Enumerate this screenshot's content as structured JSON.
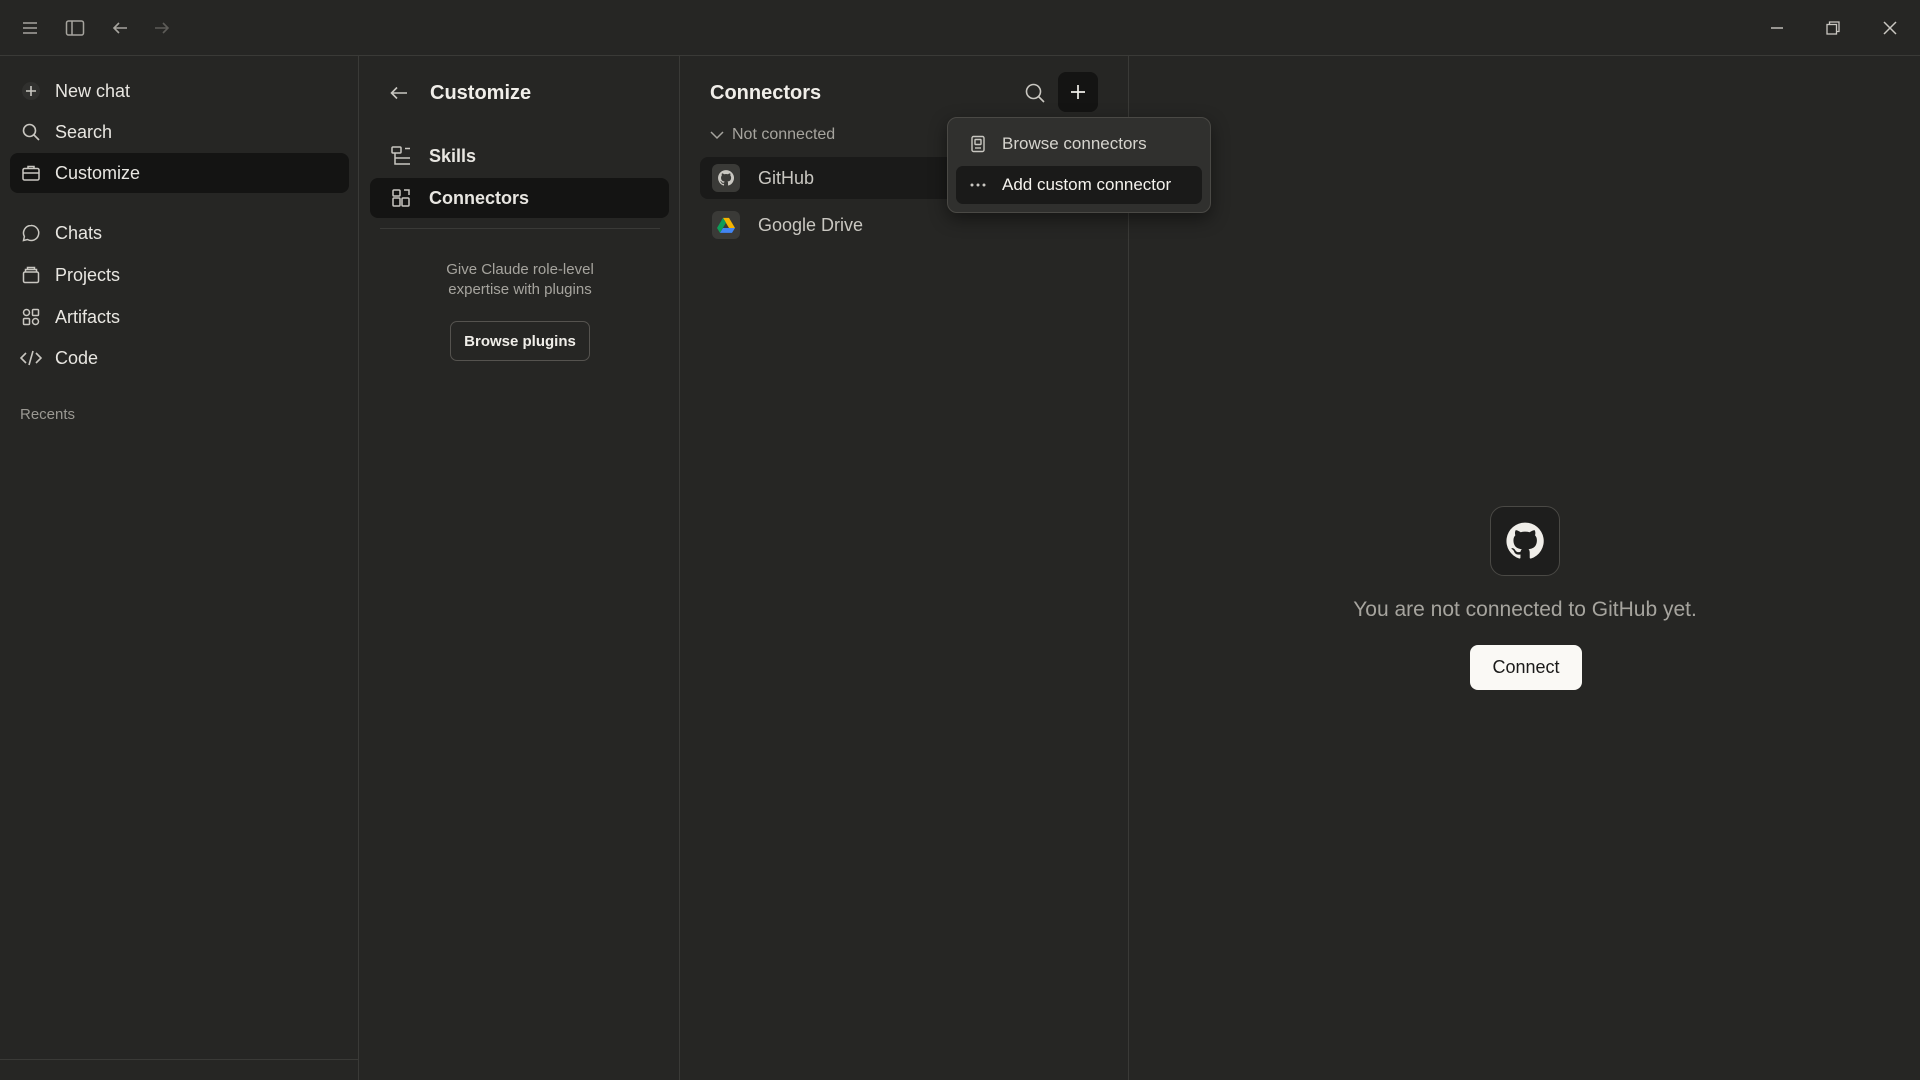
{
  "sidebar": {
    "items": [
      {
        "label": "New chat",
        "icon": "plus-icon"
      },
      {
        "label": "Search",
        "icon": "search-icon"
      },
      {
        "label": "Customize",
        "icon": "briefcase-icon"
      },
      {
        "label": "Chats",
        "icon": "chat-bubble-icon"
      },
      {
        "label": "Projects",
        "icon": "folder-stack-icon"
      },
      {
        "label": "Artifacts",
        "icon": "artifacts-grid-icon"
      },
      {
        "label": "Code",
        "icon": "code-icon"
      }
    ],
    "recents_label": "Recents"
  },
  "customize": {
    "title": "Customize",
    "items": [
      {
        "label": "Skills",
        "icon": "skills-icon"
      },
      {
        "label": "Connectors",
        "icon": "connectors-icon"
      }
    ],
    "description_line1": "Give Claude role-level",
    "description_line2": "expertise with plugins",
    "browse_plugins_label": "Browse plugins"
  },
  "connectors": {
    "title": "Connectors",
    "group_label": "Not connected",
    "items": [
      {
        "label": "GitHub",
        "icon": "github-icon"
      },
      {
        "label": "Google Drive",
        "icon": "google-drive-icon"
      }
    ]
  },
  "menu": {
    "items": [
      {
        "label": "Browse connectors",
        "icon": "book-icon"
      },
      {
        "label": "Add custom connector",
        "icon": "ellipsis-icon"
      }
    ]
  },
  "main": {
    "message": "You are not connected to GitHub yet.",
    "connect_label": "Connect"
  },
  "colors": {
    "background": "#262624",
    "active_item": "#141413",
    "connect_button": "#faf9f5"
  }
}
